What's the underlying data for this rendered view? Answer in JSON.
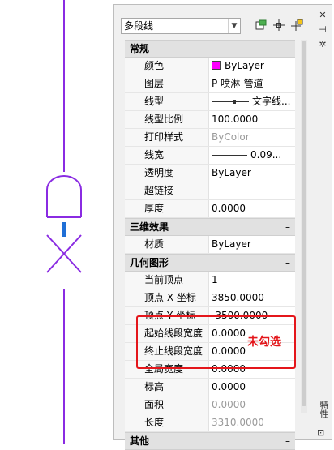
{
  "toolbar": {
    "object_type": "多段线",
    "icons": [
      "quick-select-icon",
      "select-objects-icon",
      "toggle-pickadd-icon"
    ]
  },
  "side_tools": [
    "close-icon",
    "auto-hide-icon",
    "properties-icon"
  ],
  "palette_title": "特性",
  "categories": [
    {
      "title": "常规",
      "toggle": "–",
      "rows": [
        {
          "name": "颜色",
          "value": "ByLayer"
        },
        {
          "name": "图层",
          "value": "P-喷淋-管道"
        },
        {
          "name": "线型",
          "value": "文字线..."
        },
        {
          "name": "线型比例",
          "value": "100.0000"
        },
        {
          "name": "打印样式",
          "value": "ByColor"
        },
        {
          "name": "线宽",
          "value": "0.09..."
        },
        {
          "name": "透明度",
          "value": "ByLayer"
        },
        {
          "name": "超链接",
          "value": ""
        },
        {
          "name": "厚度",
          "value": "0.0000"
        }
      ]
    },
    {
      "title": "三维效果",
      "toggle": "–",
      "rows": [
        {
          "name": "材质",
          "value": "ByLayer"
        }
      ]
    },
    {
      "title": "几何图形",
      "toggle": "–",
      "rows": [
        {
          "name": "当前顶点",
          "value": "1"
        },
        {
          "name": "顶点 X 坐标",
          "value": "3850.0000"
        },
        {
          "name": "顶点 Y 坐标",
          "value": "-3500.0000"
        },
        {
          "name": "起始线段宽度",
          "value": "0.0000"
        },
        {
          "name": "终止线段宽度",
          "value": "0.0000"
        },
        {
          "name": "全局宽度",
          "value": "0.0000"
        },
        {
          "name": "标高",
          "value": "0.0000"
        },
        {
          "name": "面积",
          "value": "0.0000"
        },
        {
          "name": "长度",
          "value": "3310.0000"
        }
      ]
    },
    {
      "title": "其他",
      "toggle": "–",
      "rows": []
    }
  ],
  "annotation": {
    "text": "未勾选"
  },
  "colors": {
    "accent_red": "#e4161b",
    "pipe_line": "#8a2be2",
    "color_swatch": "#ff00ff"
  }
}
